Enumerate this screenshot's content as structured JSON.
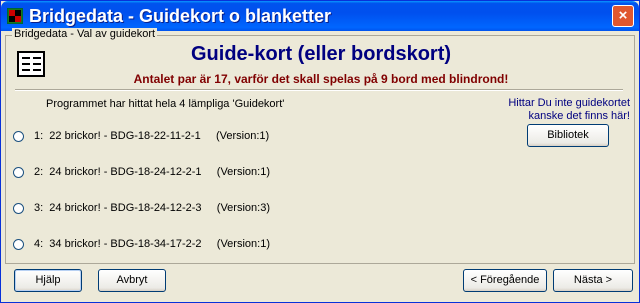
{
  "window": {
    "title": "Bridgedata - Guidekort o blanketter",
    "close_label": "×"
  },
  "group": {
    "label": "Bridgedata - Val av guidekort"
  },
  "header": {
    "heading": "Guide-kort (eller bordskort)",
    "subheading": "Antalet par är 17, varför det skall spelas på 9 bord med blindrond!"
  },
  "found_text": "Programmet har hittat hela 4 lämpliga 'Guidekort'",
  "hint": {
    "line1": "Hittar Du inte guidekortet",
    "line2": "kanske det finns här!"
  },
  "library_button": "Bibliotek",
  "options": [
    {
      "text": "1:  22 brickor! - BDG-18-22-11-2-1     (Version:1)",
      "selected": false
    },
    {
      "text": "2:  24 brickor! - BDG-18-24-12-2-1     (Version:1)",
      "selected": false
    },
    {
      "text": "3:  24 brickor! - BDG-18-24-12-2-3     (Version:3)",
      "selected": false
    },
    {
      "text": "4:  34 brickor! - BDG-18-34-17-2-2     (Version:1)",
      "selected": false
    }
  ],
  "footer": {
    "help": "Hjälp",
    "cancel": "Avbryt",
    "prev": "< Föregående",
    "next": "Nästa >"
  },
  "colors": {
    "title_bar": "#0053ee",
    "heading": "#000080",
    "subheading": "#800000",
    "face": "#ece9d8"
  }
}
